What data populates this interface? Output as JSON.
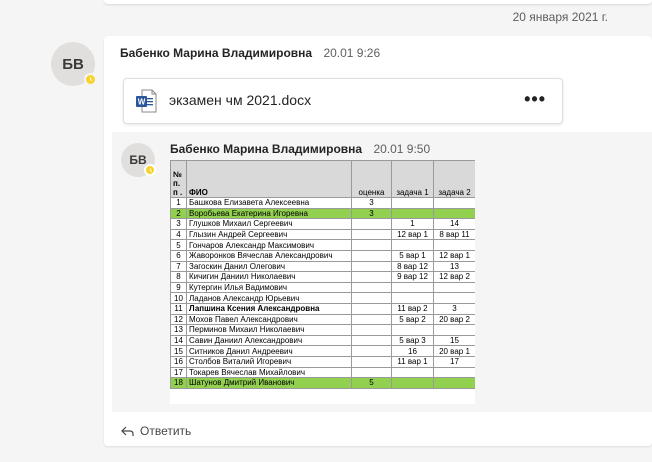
{
  "date_divider": "20 января 2021 г.",
  "message": {
    "avatar_initials": "БВ",
    "author": "Бабенко Марина Владимировна",
    "time": "20.01 9:26",
    "file_name": "экзамен чм 2021.docx",
    "more_label": "•••"
  },
  "reply": {
    "avatar_initials": "БВ",
    "author": "Бабенко Марина Владимировна",
    "time": "20.01 9:50"
  },
  "sheet": {
    "headers": [
      "№ п.п .",
      "ФИО",
      "оценка",
      "задача 1",
      "задача 2"
    ],
    "rows": [
      {
        "n": "1",
        "name": "Башкова Елизавета Алексеевна",
        "grade": "3",
        "t1": "",
        "t2": "",
        "hl": false
      },
      {
        "n": "2",
        "name": "Воробьева Екатерина Игоревна",
        "grade": "3",
        "t1": "",
        "t2": "",
        "hl": true
      },
      {
        "n": "3",
        "name": "Глушков Михаил Сергеевич",
        "grade": "",
        "t1": "1",
        "t2": "14",
        "hl": false
      },
      {
        "n": "4",
        "name": "Глызин Андрей Сергеевич",
        "grade": "",
        "t1": "12 вар 1",
        "t2": "8 вар 11",
        "hl": false
      },
      {
        "n": "5",
        "name": "Гончаров Александр Максимович",
        "grade": "",
        "t1": "",
        "t2": "",
        "hl": false
      },
      {
        "n": "6",
        "name": "Жаворонков Вячеслав Александрович",
        "grade": "",
        "t1": "5 вар 1",
        "t2": "12 вар 1",
        "hl": false
      },
      {
        "n": "7",
        "name": "Загоскин Данил Олегович",
        "grade": "",
        "t1": "8 вар 12",
        "t2": "13",
        "hl": false
      },
      {
        "n": "8",
        "name": "Кичигин Даниил Николаевич",
        "grade": "",
        "t1": "9 вар 12",
        "t2": "12 вар 2",
        "hl": false
      },
      {
        "n": "9",
        "name": "Кутергин Илья Вадимович",
        "grade": "",
        "t1": "",
        "t2": "",
        "hl": false
      },
      {
        "n": "10",
        "name": "Ладанов Александр Юрьевич",
        "grade": "",
        "t1": "",
        "t2": "",
        "hl": false
      },
      {
        "n": "11",
        "name": "Лапшина Ксения Александровна",
        "grade": "",
        "t1": "11 вар 2",
        "t2": "3",
        "hl": false
      },
      {
        "n": "12",
        "name": "Мохов Павел Александрович",
        "grade": "",
        "t1": "5 вар 2",
        "t2": "20 вар 2",
        "hl": false
      },
      {
        "n": "13",
        "name": "Перминов Михаил Николаевич",
        "grade": "",
        "t1": "",
        "t2": "",
        "hl": false
      },
      {
        "n": "14",
        "name": "Савин Даниил Александрович",
        "grade": "",
        "t1": "5 вар 3",
        "t2": "15",
        "hl": false
      },
      {
        "n": "15",
        "name": "Ситников Данил Андреевич",
        "grade": "",
        "t1": "16",
        "t2": "20 вар 1",
        "hl": false
      },
      {
        "n": "16",
        "name": "Столбов Виталий Игоревич",
        "grade": "",
        "t1": "11 вар 1",
        "t2": "17",
        "hl": false
      },
      {
        "n": "17",
        "name": "Токарев Вячеслав Михайлович",
        "grade": "",
        "t1": "",
        "t2": "",
        "hl": false
      },
      {
        "n": "18",
        "name": "Шатунов Дмитрий Иванович",
        "grade": "5",
        "t1": "",
        "t2": "",
        "hl": true
      }
    ]
  },
  "reply_action": "Ответить",
  "colors": {
    "presence": "#f8d22a",
    "highlight_row": "#92d050",
    "word_blue": "#2b579a"
  }
}
